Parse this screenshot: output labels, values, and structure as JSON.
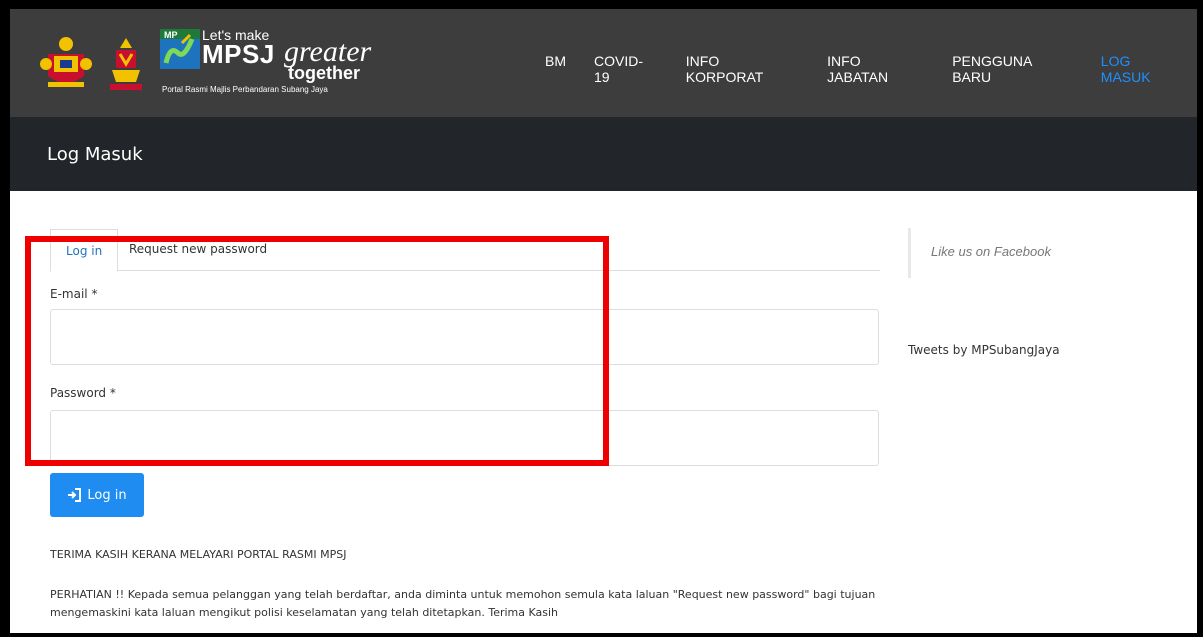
{
  "header": {
    "brand": {
      "lets_make": "Let's make",
      "mpsj": "MPSJ",
      "greater": "greater",
      "together": "together",
      "portal": "Portal Rasmi Majlis Perbandaran Subang Jaya"
    },
    "nav": [
      {
        "label": "BM",
        "active": false
      },
      {
        "label": "COVID-19",
        "active": false
      },
      {
        "label": "INFO KORPORAT",
        "active": false
      },
      {
        "label": "INFO JABATAN",
        "active": false
      },
      {
        "label": "PENGGUNA BARU",
        "active": false
      },
      {
        "label": "LOG MASUK",
        "active": true
      }
    ],
    "active_color": "#1e90ff"
  },
  "page_title": "Log Masuk",
  "tabs": [
    {
      "label": "Log in",
      "active": true
    },
    {
      "label": "Request new password",
      "active": false
    }
  ],
  "form": {
    "email_label": "E-mail *",
    "email_value": "",
    "password_label": "Password *",
    "password_value": "",
    "submit_label": "Log in",
    "submit_icon": "sign-in-icon",
    "button_color": "#1e8cf0"
  },
  "notices": {
    "thanks": "TERIMA KASIH KERANA MELAYARI PORTAL RASMI MPSJ",
    "attention": "PERHATIAN !! Kepada semua pelanggan yang telah berdaftar, anda diminta untuk memohon semula kata laluan \"Request new password\" bagi tujuan mengemaskini kata laluan mengikut polisi keselamatan yang telah ditetapkan. Terima Kasih"
  },
  "sidebar": {
    "facebook": "Like us on Facebook",
    "tweets": "Tweets by MPSubangJaya"
  },
  "highlight_color": "#ee0000"
}
